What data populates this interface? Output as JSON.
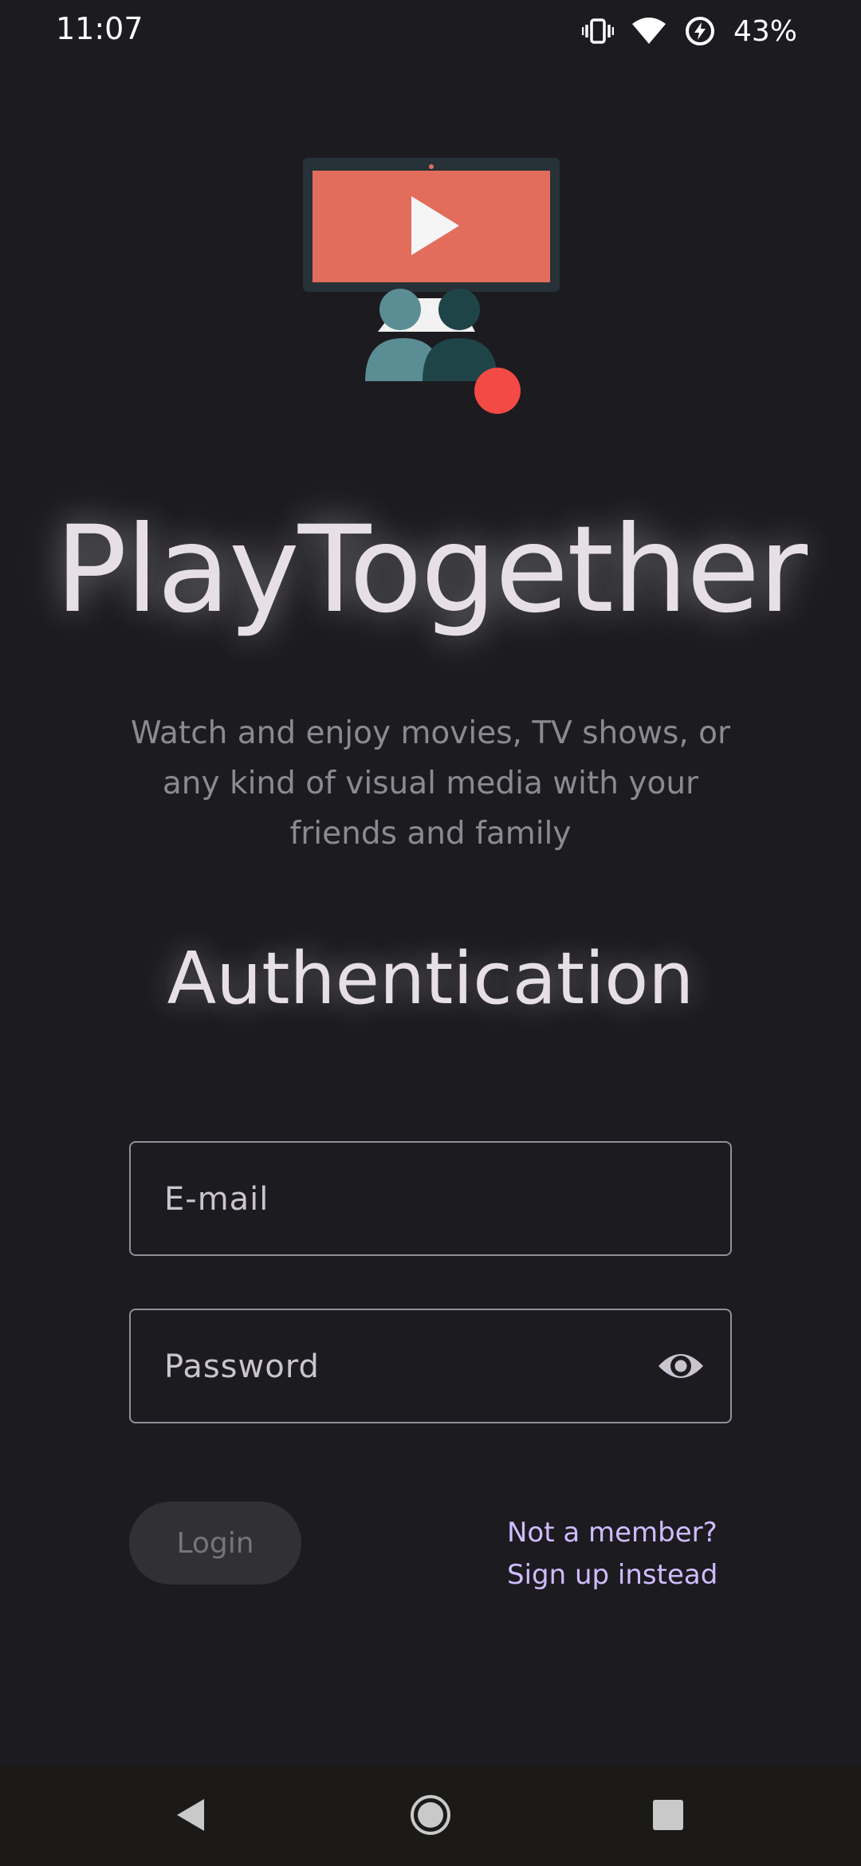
{
  "status_bar": {
    "time": "11:07",
    "battery_percent": "43%",
    "icons": [
      "vibrate-icon",
      "wifi-icon",
      "battery-saver-icon"
    ]
  },
  "logo": {
    "icon": "watch-party-logo",
    "colors": {
      "screen": "#e36d5d",
      "frame": "#263238",
      "play": "#f5f5f5",
      "person_light": "#5b8e94",
      "person_dark": "#1f4448",
      "record_dot": "#f34a45"
    }
  },
  "app_title": "PlayTogether",
  "subtitle": "Watch and enjoy movies, TV shows, or any kind of visual media with your friends and family",
  "section_title": "Authentication",
  "form": {
    "email_placeholder": "E-mail",
    "email_value": "",
    "password_placeholder": "Password",
    "password_value": "",
    "password_toggle_icon": "eye-icon",
    "login_label": "Login",
    "signup_line1": "Not a member?",
    "signup_line2": "Sign up instead"
  },
  "nav_bar": {
    "buttons": [
      "back-icon",
      "home-icon",
      "recents-icon"
    ]
  },
  "colors": {
    "background": "#1c1b20",
    "accent_link": "#d0bcff",
    "field_border": "#938f99",
    "button_disabled_bg": "#313035"
  }
}
